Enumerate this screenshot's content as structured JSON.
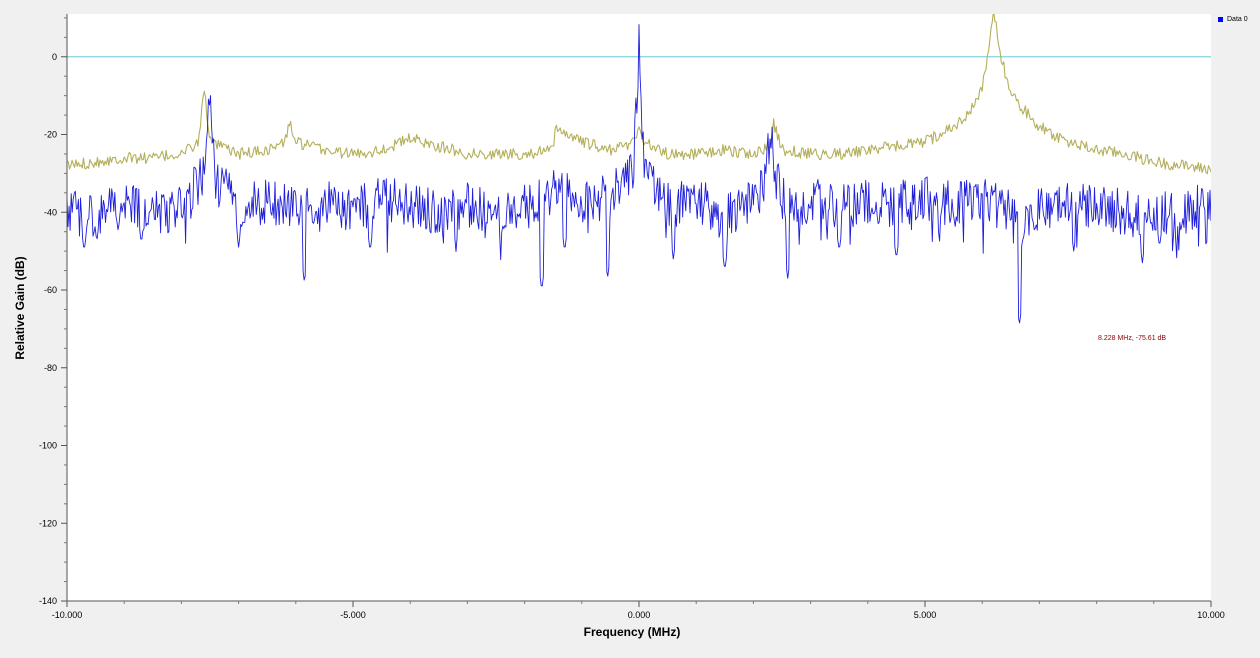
{
  "chart_data": {
    "type": "line",
    "xlabel": "Frequency (MHz)",
    "ylabel": "Relative Gain (dB)",
    "xlim": [
      -10,
      10
    ],
    "ylim": [
      -140,
      11
    ],
    "x_ticks": [
      -10,
      -5,
      0,
      5,
      10
    ],
    "x_tick_labels": [
      "-10.000",
      "-5.000",
      "0.000",
      "5.000",
      "10.000"
    ],
    "y_ticks": [
      0,
      -20,
      -40,
      -60,
      -80,
      -100,
      -120,
      -140
    ],
    "y_tick_labels": [
      "0",
      "-20",
      "-40",
      "-60",
      "-80",
      "-100",
      "-120",
      "-140"
    ],
    "grid": false,
    "legend_position": "top-right",
    "legend": [
      {
        "label": "Data 0",
        "color": "#0000ff"
      }
    ],
    "reference_line": {
      "y": 0,
      "color": "#7fd4e0"
    },
    "marker_annotation": "8.228 MHz, -75.61 dB",
    "series": [
      {
        "color": "#1e1edc",
        "style": "noisy",
        "baseline": -39,
        "noise_amplitude": 6,
        "x": [
          -10.0,
          -9.5,
          -9.0,
          -8.5,
          -8.0,
          -7.6,
          -7.5,
          -7.4,
          -7.0,
          -6.5,
          -6.0,
          -5.5,
          -5.0,
          -4.5,
          -4.0,
          -3.5,
          -3.0,
          -2.5,
          -2.0,
          -1.5,
          -1.0,
          -0.5,
          -0.1,
          0.0,
          0.1,
          0.5,
          1.0,
          1.5,
          2.0,
          2.2,
          2.3,
          2.4,
          2.6,
          3.0,
          3.5,
          4.0,
          4.5,
          5.0,
          5.5,
          6.0,
          6.5,
          6.7,
          7.0,
          7.5,
          8.0,
          8.5,
          9.0,
          9.5,
          10.0
        ],
        "y": [
          -40,
          -41,
          -38,
          -40,
          -39,
          -30,
          -12,
          -32,
          -38,
          -37,
          -39,
          -37,
          -40,
          -36,
          -39,
          -40,
          -38,
          -40,
          -39,
          -35,
          -37,
          -36,
          -30,
          3,
          -30,
          -38,
          -37,
          -40,
          -38,
          -32,
          -19,
          -32,
          -39,
          -37,
          -39,
          -37,
          -38,
          -36,
          -38,
          -37,
          -39,
          -46,
          -38,
          -38,
          -39,
          -40,
          -40,
          -41,
          -37
        ],
        "dips": [
          [
            -9.7,
            -50
          ],
          [
            -8.7,
            -48
          ],
          [
            -7.0,
            -49
          ],
          [
            -5.85,
            -58
          ],
          [
            -4.7,
            -50
          ],
          [
            -3.2,
            -49
          ],
          [
            -1.7,
            -60
          ],
          [
            -1.3,
            -50
          ],
          [
            -0.55,
            -57
          ],
          [
            0.6,
            -52
          ],
          [
            1.5,
            -55
          ],
          [
            2.6,
            -57
          ],
          [
            3.5,
            -50
          ],
          [
            4.5,
            -52
          ],
          [
            6.65,
            -69
          ],
          [
            7.6,
            -50
          ],
          [
            8.8,
            -53
          ],
          [
            9.1,
            -49
          ]
        ]
      },
      {
        "color": "#b4af5a",
        "style": "noisy",
        "baseline": -26,
        "noise_amplitude": 1.5,
        "x": [
          -10.0,
          -9.5,
          -9.0,
          -8.5,
          -8.0,
          -7.7,
          -7.6,
          -7.5,
          -7.0,
          -6.5,
          -6.2,
          -6.1,
          -6.0,
          -5.5,
          -5.0,
          -4.5,
          -4.0,
          -3.5,
          -3.0,
          -2.5,
          -2.0,
          -1.5,
          -1.45,
          -1.0,
          -0.5,
          -0.1,
          0.0,
          0.1,
          0.5,
          1.0,
          1.5,
          2.0,
          2.3,
          2.35,
          2.5,
          3.0,
          3.5,
          4.0,
          4.5,
          5.0,
          5.5,
          5.8,
          6.0,
          6.1,
          6.2,
          6.3,
          6.5,
          7.0,
          7.5,
          8.0,
          8.5,
          9.0,
          9.5,
          10.0
        ],
        "y": [
          -28,
          -27,
          -26,
          -26,
          -25,
          -22,
          -8,
          -22,
          -25,
          -24,
          -22,
          -17,
          -22,
          -24,
          -25,
          -24,
          -21,
          -23,
          -25,
          -25,
          -25,
          -24,
          -18,
          -22,
          -24,
          -22,
          -18,
          -22,
          -25,
          -25,
          -24,
          -25,
          -23,
          -17,
          -24,
          -25,
          -25,
          -24,
          -23,
          -22,
          -18,
          -14,
          -8,
          0,
          12,
          2,
          -10,
          -18,
          -22,
          -24,
          -25,
          -27,
          -28,
          -29
        ]
      }
    ]
  }
}
